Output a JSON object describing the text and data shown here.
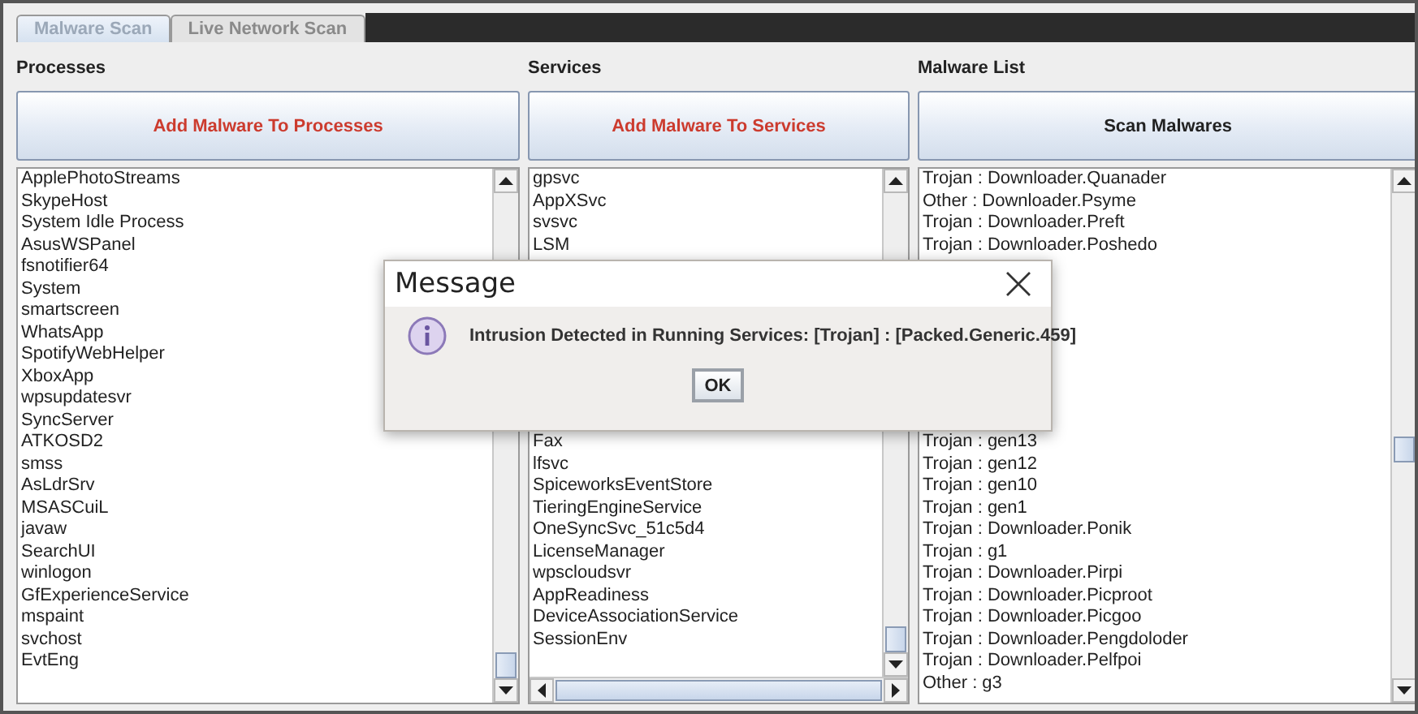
{
  "tabs": [
    {
      "label": "Malware Scan",
      "selected": true
    },
    {
      "label": "Live Network Scan",
      "selected": false
    }
  ],
  "columns": [
    {
      "heading": "Processes",
      "button": {
        "label": "Add Malware To Processes",
        "kind": "add"
      },
      "horizontal_scrollbar": false,
      "rows": [
        "ApplePhotoStreams",
        "SkypeHost",
        "System Idle Process",
        "AsusWSPanel",
        "fsnotifier64",
        "System",
        "smartscreen",
        "WhatsApp",
        "SpotifyWebHelper",
        "XboxApp",
        "wpsupdatesvr",
        "SyncServer",
        "ATKOSD2",
        "smss",
        "AsLdrSrv",
        "MSASCuiL",
        "javaw",
        "SearchUI",
        "winlogon",
        "GfExperienceService",
        "mspaint",
        "svchost",
        "EvtEng"
      ]
    },
    {
      "heading": "Services",
      "button": {
        "label": "Add Malware To Services",
        "kind": "add"
      },
      "horizontal_scrollbar": true,
      "rows": [
        "gpsvc",
        "AppXSvc",
        "svsvc",
        "LSM"
      ],
      "rows_below": [
        "Fax",
        "lfsvc",
        "SpiceworksEventStore",
        "TieringEngineService",
        "OneSyncSvc_51c5d4",
        "LicenseManager",
        "wpscloudsvr",
        "AppReadiness",
        "DeviceAssociationService",
        "SessionEnv"
      ]
    },
    {
      "heading": "Malware List",
      "button": {
        "label": "Scan Malwares",
        "kind": "scan"
      },
      "horizontal_scrollbar": false,
      "rows": [
        "Trojan : Downloader.Quanader",
        "Other : Downloader.Psyme",
        "Trojan : Downloader.Preft",
        "Trojan : Downloader.Poshedo"
      ],
      "rows_below": [
        "Trojan : gen13",
        "Trojan : gen12",
        "Trojan : gen10",
        "Trojan : gen1",
        "Trojan : Downloader.Ponik",
        "Trojan : g1",
        "Trojan : Downloader.Pirpi",
        "Trojan : Downloader.Picproot",
        "Trojan : Downloader.Picgoo",
        "Trojan : Downloader.Pengdoloder",
        "Trojan : Downloader.Pelfpoi",
        "Other : g3"
      ]
    }
  ],
  "dialog": {
    "title": "Message",
    "message": "Intrusion Detected in Running Services: [Trojan] : [Packed.Generic.459]",
    "button": "OK"
  }
}
